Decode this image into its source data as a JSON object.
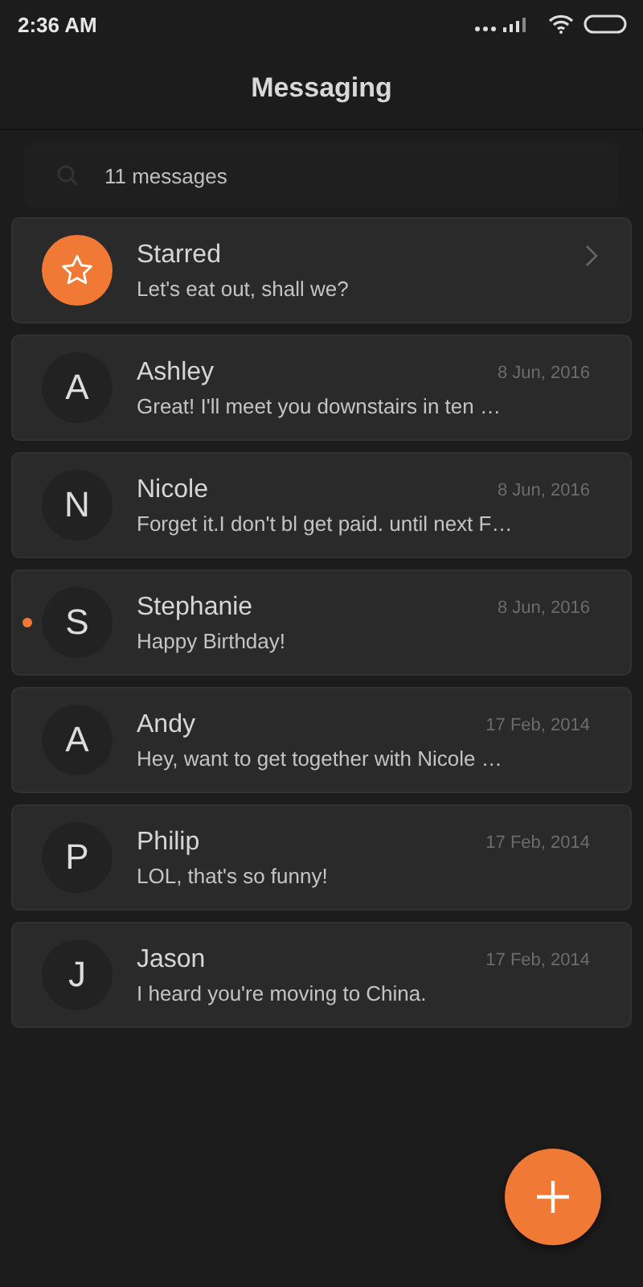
{
  "status_bar": {
    "time": "2:36 AM"
  },
  "header": {
    "title": "Messaging"
  },
  "search": {
    "placeholder": "11 messages"
  },
  "conversations": [
    {
      "kind": "starred",
      "name": "Starred",
      "preview": "Let's eat out, shall we?",
      "unread": false
    },
    {
      "kind": "conversation",
      "initial": "A",
      "name": "Ashley",
      "preview": "Great! I'll meet you downstairs in ten …",
      "date": "8 Jun, 2016",
      "unread": false
    },
    {
      "kind": "conversation",
      "initial": "N",
      "name": "Nicole",
      "preview": "Forget it.I don't bl get paid. until next F…",
      "date": "8 Jun, 2016",
      "unread": false
    },
    {
      "kind": "conversation",
      "initial": "S",
      "name": "Stephanie",
      "preview": "Happy Birthday!",
      "date": "8 Jun, 2016",
      "unread": true
    },
    {
      "kind": "conversation",
      "initial": "A",
      "name": "Andy",
      "preview": "Hey, want to get together with Nicole …",
      "date": "17 Feb, 2014",
      "unread": false
    },
    {
      "kind": "conversation",
      "initial": "P",
      "name": "Philip",
      "preview": "LOL, that's so funny!",
      "date": "17 Feb, 2014",
      "unread": false
    },
    {
      "kind": "conversation",
      "initial": "J",
      "name": "Jason",
      "preview": "I heard you're moving to China.",
      "date": "17 Feb, 2014",
      "unread": false
    }
  ]
}
